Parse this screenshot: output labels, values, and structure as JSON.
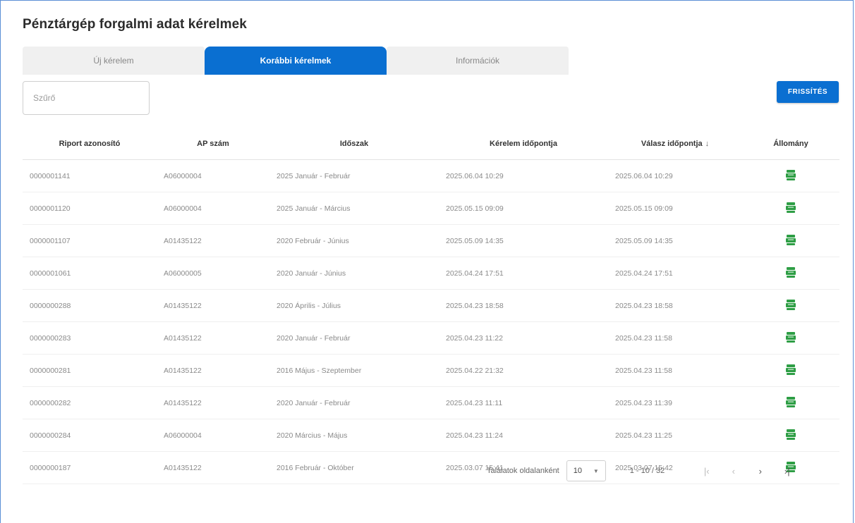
{
  "page": {
    "title": "Pénztárgép forgalmi adat kérelmek"
  },
  "tabs": [
    {
      "label": "Új kérelem"
    },
    {
      "label": "Korábbi kérelmek"
    },
    {
      "label": "Információk"
    }
  ],
  "filter": {
    "placeholder": "Szűrő",
    "value": ""
  },
  "toolbar": {
    "refresh_label": "FRISSÍTÉS"
  },
  "table": {
    "headers": [
      "Riport azonosító",
      "AP szám",
      "Időszak",
      "Kérelem időpontja",
      "Válasz időpontja",
      "Állomány"
    ],
    "sort_indicator": "↓",
    "rows": [
      [
        "0000001141",
        "A06000004",
        "2025 Január - Február",
        "2025.06.04 10:29",
        "2025.06.04 10:29"
      ],
      [
        "0000001120",
        "A06000004",
        "2025 Január - Március",
        "2025.05.15 09:09",
        "2025.05.15 09:09"
      ],
      [
        "0000001107",
        "A01435122",
        "2020 Február - Június",
        "2025.05.09 14:35",
        "2025.05.09 14:35"
      ],
      [
        "0000001061",
        "A06000005",
        "2020 Január - Június",
        "2025.04.24 17:51",
        "2025.04.24 17:51"
      ],
      [
        "0000000288",
        "A01435122",
        "2020 Április - Július",
        "2025.04.23 18:58",
        "2025.04.23 18:58"
      ],
      [
        "0000000283",
        "A01435122",
        "2020 Január - Február",
        "2025.04.23 11:22",
        "2025.04.23 11:58"
      ],
      [
        "0000000281",
        "A01435122",
        "2016 Május - Szeptember",
        "2025.04.22 21:32",
        "2025.04.23 11:58"
      ],
      [
        "0000000282",
        "A01435122",
        "2020 Január - Február",
        "2025.04.23 11:11",
        "2025.04.23 11:39"
      ],
      [
        "0000000284",
        "A06000004",
        "2020 Március - Május",
        "2025.04.23 11:24",
        "2025.04.23 11:25"
      ],
      [
        "0000000187",
        "A01435122",
        "2016 Február - Október",
        "2025.03.07 15:41",
        "2025.03.07 15:42"
      ]
    ]
  },
  "pagination": {
    "label": "Találatok oldalanként",
    "page_size": "10",
    "range": "1 - 10 / 32",
    "first": "|‹",
    "prev": "‹",
    "next": "›",
    "last": "›|"
  },
  "colors": {
    "accent": "#0a6fd1",
    "file_icon": "#2e9e45"
  }
}
